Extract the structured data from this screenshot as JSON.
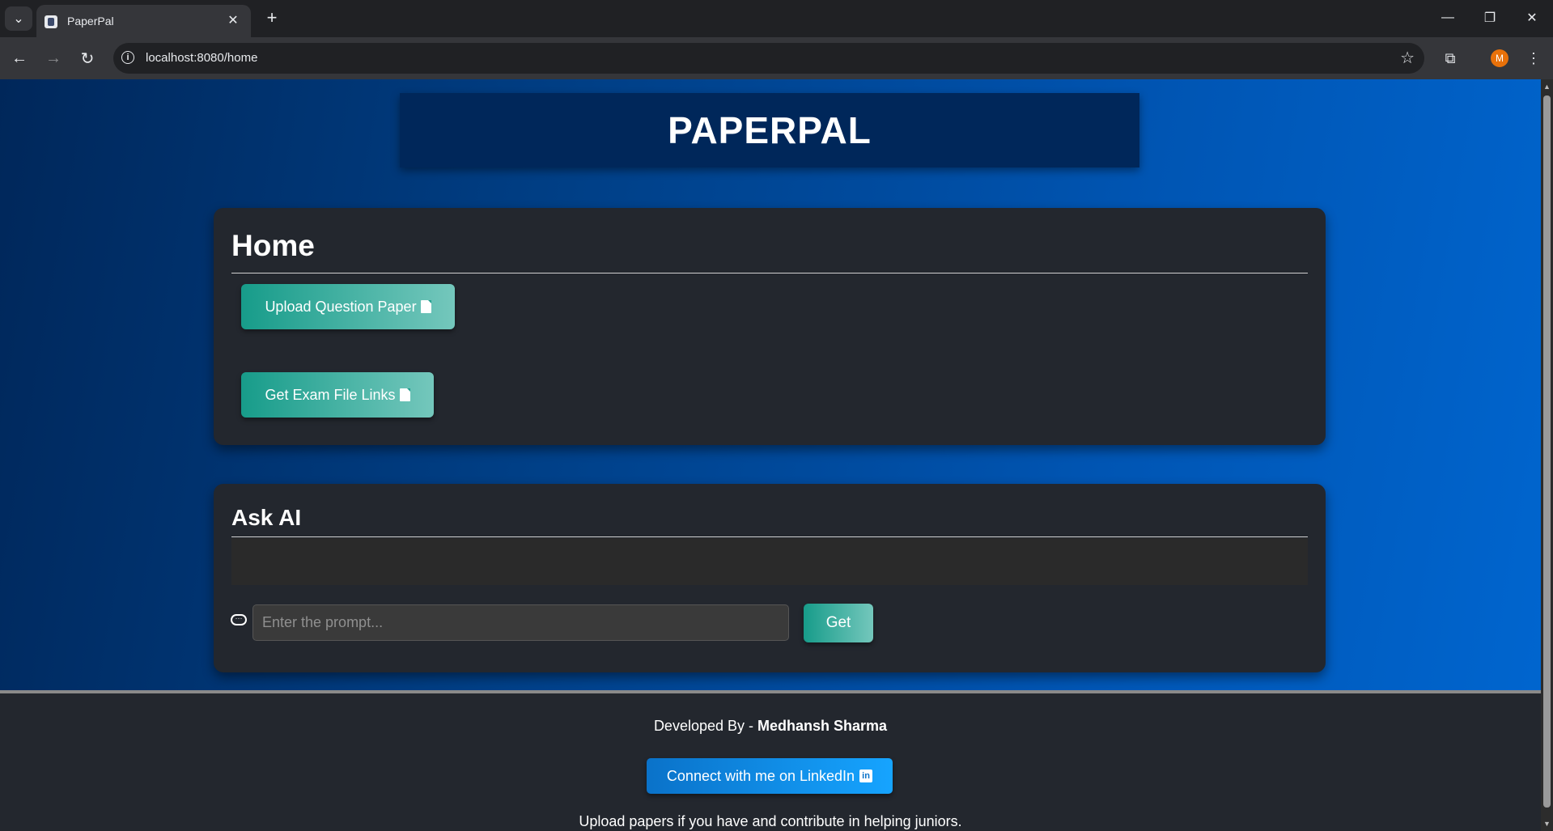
{
  "browser": {
    "tab_title": "PaperPal",
    "url": "localhost:8080/home",
    "profile_initial": "M"
  },
  "header": {
    "title": "PAPERPAL"
  },
  "home": {
    "title": "Home",
    "upload_label": "Upload Question Paper",
    "links_label": "Get Exam File Links"
  },
  "ask_ai": {
    "title": "Ask AI",
    "output": "",
    "prompt_placeholder": "Enter the prompt...",
    "get_label": "Get"
  },
  "footer": {
    "developed_by_prefix": "Developed By - ",
    "developer_name": "Medhansh Sharma",
    "linkedin_label": "Connect with me on LinkedIn",
    "note": "Upload papers if you have and contribute in helping juniors."
  },
  "colors": {
    "accent_teal": "#179c8a",
    "linkedin_blue": "#0a72c9",
    "card_bg": "#23272e",
    "page_gradient_end": "#0066d0"
  }
}
